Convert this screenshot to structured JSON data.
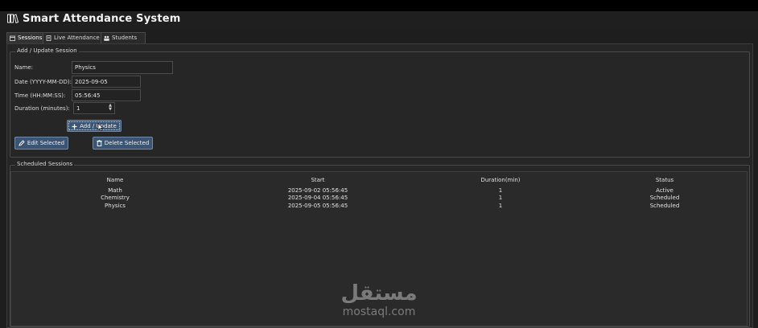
{
  "app": {
    "title": "Smart Attendance System"
  },
  "tabs": [
    {
      "label": "Sessions",
      "icon": "calendar-icon"
    },
    {
      "label": "Live Attendance",
      "icon": "document-icon"
    },
    {
      "label": "Students",
      "icon": "people-icon"
    }
  ],
  "form": {
    "group_title": "Add / Update Session",
    "name_label": "Name:",
    "name_value": "Physics",
    "date_label": "Date (YYYY-MM-DD):",
    "date_value": "2025-09-05",
    "time_label": "Time (HH:MM:SS):",
    "time_value": "05:56:45",
    "duration_label": "Duration (minutes):",
    "duration_value": "1",
    "add_update_label": "Add / Update",
    "edit_label": "Edit Selected",
    "delete_label": "Delete Selected"
  },
  "sessions": {
    "group_title": "Scheduled Sessions",
    "columns": [
      "Name",
      "Start",
      "Duration(min)",
      "Status"
    ],
    "rows": [
      [
        "Math",
        "2025-09-02 05:56:45",
        "1",
        "Active"
      ],
      [
        "Chemistry",
        "2025-09-04 05:56:45",
        "1",
        "Scheduled"
      ],
      [
        "Physics",
        "2025-09-05 05:56:45",
        "1",
        "Scheduled"
      ]
    ]
  },
  "watermark": {
    "arabic": "مستقل",
    "latin": "mostaql.com"
  },
  "colors": {
    "background": "#1e1e1e",
    "button": "#3b5573",
    "button_border": "#6f8aa8"
  }
}
